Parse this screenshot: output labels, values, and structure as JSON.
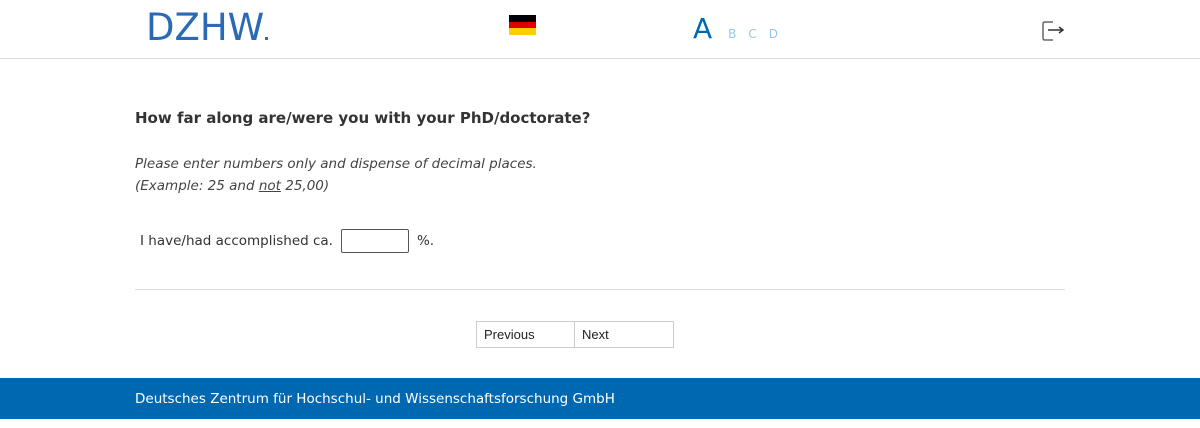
{
  "header": {
    "logo_text": "DZHW",
    "language_flag": "germany-flag-icon",
    "progress_steps": [
      {
        "label": "A",
        "state": "current"
      },
      {
        "label": "B",
        "state": "pending"
      },
      {
        "label": "C",
        "state": "pending"
      },
      {
        "label": "D",
        "state": "pending"
      }
    ],
    "exit_icon": "exit-icon"
  },
  "question": {
    "title": "How far along are/were you with your PhD/doctorate?",
    "instruction_line1": "Please enter numbers only and dispense of decimal places.",
    "instruction_line2_before": "(Example: 25 and ",
    "instruction_line2_underlined": "not",
    "instruction_line2_after": " 25,00)",
    "answer_prefix": "I have/had accomplished ca.",
    "answer_value": "",
    "answer_suffix": "%."
  },
  "navigation": {
    "previous_label": "Previous",
    "next_label": "Next"
  },
  "footer": {
    "text": "Deutsches Zentrum für Hochschul- und Wissenschaftsforschung GmbH"
  },
  "colors": {
    "brand_blue": "#0067b1",
    "logo_blue": "#2a6ab4",
    "pending_step": "#9cc6e6",
    "flag_black": "#000000",
    "flag_red": "#dd0000",
    "flag_gold": "#ffce00"
  }
}
